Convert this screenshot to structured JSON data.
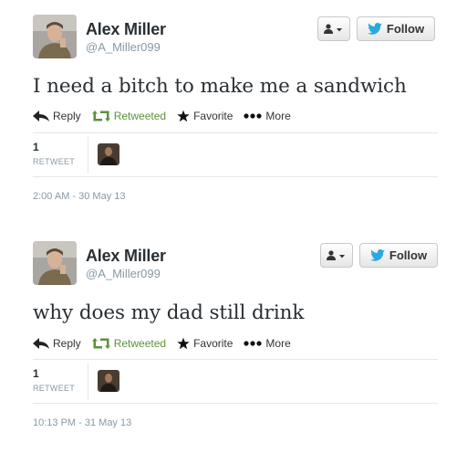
{
  "tweets": [
    {
      "author_name": "Alex Miller",
      "handle": "@A_Miller099",
      "follow_label": "Follow",
      "text": "I need a bitch to make me a sandwich",
      "actions": {
        "reply": "Reply",
        "retweeted": "Retweeted",
        "favorite": "Favorite",
        "more": "More"
      },
      "retweet_count": "1",
      "retweet_label": "RETWEET",
      "timestamp": "2:00 AM - 30 May 13"
    },
    {
      "author_name": "Alex Miller",
      "handle": "@A_Miller099",
      "follow_label": "Follow",
      "text": "why does my dad still drink",
      "actions": {
        "reply": "Reply",
        "retweeted": "Retweeted",
        "favorite": "Favorite",
        "more": "More"
      },
      "retweet_count": "1",
      "retweet_label": "RETWEET",
      "timestamp": "10:13 PM - 31 May 13"
    }
  ],
  "colors": {
    "twitter_blue": "#2aa9e0",
    "retweet_green": "#5c913b",
    "muted_gray": "#8899a6",
    "text_dark": "#292f33"
  },
  "icons": [
    "user-dropdown-icon",
    "twitter-bird-icon",
    "reply-arrow-icon",
    "retweet-icon",
    "star-icon",
    "more-dots-icon"
  ]
}
